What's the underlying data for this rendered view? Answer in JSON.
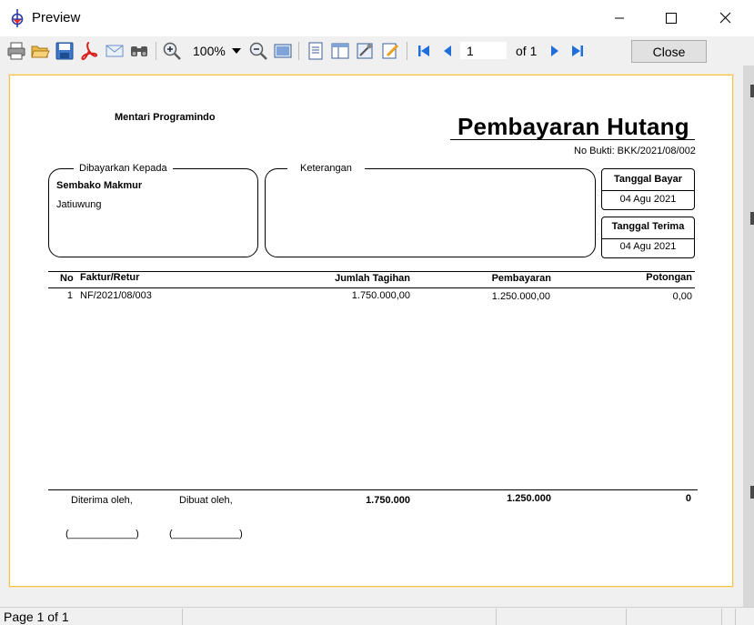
{
  "window": {
    "title": "Preview",
    "minimize_icon": "minimize-icon",
    "maximize_icon": "maximize-icon",
    "close_icon": "close-icon"
  },
  "toolbar": {
    "icons": [
      "print-icon",
      "open-icon",
      "save-icon",
      "pdf-icon",
      "email-icon",
      "find-icon",
      "zoom-in-icon",
      "zoom-out-icon",
      "page-view-icon",
      "single-page-icon",
      "multi-page-icon",
      "tools-icon",
      "edit-icon",
      "first-page-icon",
      "prev-page-icon",
      "next-page-icon",
      "last-page-icon"
    ],
    "zoom": "100%",
    "page_number": "1",
    "of_label": "of 1",
    "close_label": "Close"
  },
  "report": {
    "company": "Mentari Programindo",
    "title": "Pembayaran Hutang",
    "no_bukti": "No Bukti: BKK/2021/08/002",
    "paid_to": {
      "legend": "Dibayarkan Kepada",
      "name": "Sembako Makmur",
      "address": "Jatiuwung"
    },
    "notes": {
      "legend": "Keterangan"
    },
    "payment_date": {
      "label": "Tanggal Bayar",
      "value": "04 Agu 2021"
    },
    "receive_date": {
      "label": "Tanggal Terima",
      "value": "04 Agu 2021"
    },
    "table": {
      "headers": {
        "no": "No",
        "invoice": "Faktur/Retur",
        "amount_due": "Jumlah Tagihan",
        "payment": "Pembayaran",
        "discount": "Potongan"
      },
      "rows": [
        {
          "no": "1",
          "invoice": "NF/2021/08/003",
          "amount_due": "1.750.000,00",
          "payment": "1.250.000,00",
          "discount": "0,00"
        }
      ]
    },
    "footer": {
      "received_by": "Diterima oleh,",
      "made_by": "Dibuat oleh,",
      "total_amount_due": "1.750.000",
      "total_payment": "1.250.000",
      "total_discount": "0",
      "signature_received": "(____________)",
      "signature_made": "(____________)"
    }
  },
  "status": {
    "page_info": "Page 1 of 1"
  },
  "colors": {
    "page_border": "#f2c152",
    "toolbar_bg": "#f0f0f0",
    "accent_blue": "#1e6fd9"
  }
}
